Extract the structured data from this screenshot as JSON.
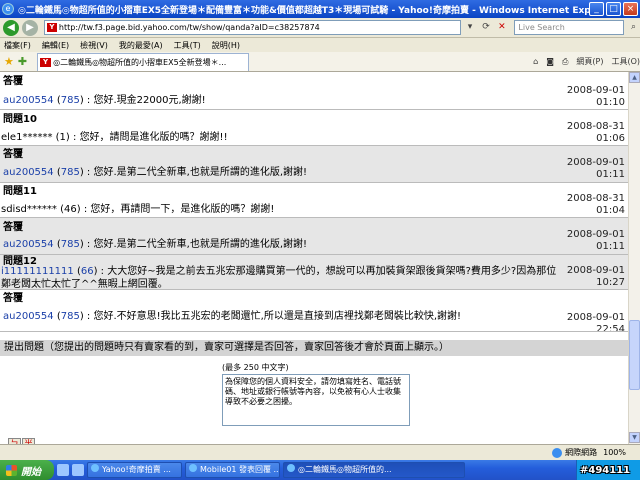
{
  "window": {
    "title": "◎二輪鐵馬◎物超所值的小摺車EX5全新登場＊配備豐富＊功能&價值都超越T3＊現場可試騎 - Yahoo!奇摩拍賣 - Windows Internet Explorer",
    "min_label": "_",
    "max_label": "□",
    "close_label": "×"
  },
  "address_bar": {
    "url": "http://tw.f3.page.bid.yahoo.com/tw/show/qanda?aID=c38257874",
    "search_placeholder": "Live Search"
  },
  "menu": [
    "檔案(F)",
    "編輯(E)",
    "檢視(V)",
    "我的最愛(A)",
    "工具(T)",
    "說明(H)"
  ],
  "tab": {
    "title": "◎二輪鐵馬◎物超所值的小摺車EX5全新登場＊..."
  },
  "favtools": {
    "page_label": "網頁(P)",
    "tools_label": "工具(O)"
  },
  "qa": [
    {
      "kind": "answer",
      "header": "答覆",
      "user": "au200554",
      "count": "785",
      "text": "您好.現金22000元,謝謝!",
      "date": "2008-09-01",
      "time": "01:10"
    },
    {
      "kind": "question",
      "header": "問題10",
      "user": "ele1******",
      "count": "1",
      "text": "您好，請問是進化版的嗎？謝謝!!",
      "date": "2008-08-31",
      "time": "01:06"
    },
    {
      "kind": "answer",
      "header": "答覆",
      "user": "au200554",
      "count": "785",
      "text": "您好.是第二代全新車,也就是所謂的進化版,謝謝!",
      "date": "2008-09-01",
      "time": "01:11"
    },
    {
      "kind": "question",
      "header": "問題11",
      "user": "sdisd******",
      "count": "46",
      "text": "您好，再請問一下，是進化版的嗎？謝謝!",
      "date": "2008-08-31",
      "time": "01:04"
    },
    {
      "kind": "answer",
      "header": "答覆",
      "user": "au200554",
      "count": "785",
      "text": "您好.是第二代全新車,也就是所謂的進化版,謝謝!",
      "date": "2008-09-01",
      "time": "01:11"
    },
    {
      "kind": "question",
      "header": "問題12",
      "user": "i11111111111",
      "count": "66",
      "text": "大大您好~我是之前去五兆宏那邊購買第一代的，想說可以再加裝貨架跟後貨架嗎?費用多少?因為那位鄭老闆太忙太忙了^^無暇上網回覆。",
      "date": "2008-09-01",
      "time": "10:27"
    },
    {
      "kind": "answer",
      "header": "答覆",
      "user": "au200554",
      "count": "785",
      "text": "您好.不好意思!我比五兆宏的老闆還忙,所以還是直接到店裡找鄭老闆裝比較快,謝謝!",
      "date": "2008-09-01",
      "time": "22:54"
    }
  ],
  "ask": {
    "label": "提出問題（您提出的問題時只有賣家看的到，賣家可選擇是否回答，賣家回答後才會於頁面上顯示。）",
    "maxlen": "(最多 250 中文字)",
    "textarea_value": "為保障您的個人資料安全，請勿填寫姓名、電話號碼、地址或銀行帳號等內容，以免被有心人士收集導致不必要之困擾。"
  },
  "ime": [
    "ㄅ",
    "半"
  ],
  "status": {
    "network": "網際網路",
    "zoom": "100%"
  },
  "taskbar": {
    "start": "開始",
    "buttons": [
      "Yahoo!奇摩拍賣 ...",
      "Mobile01 發表回覆 ...",
      "◎二輪鐵馬◎物超所值的..."
    ]
  },
  "watermark": "#494111"
}
